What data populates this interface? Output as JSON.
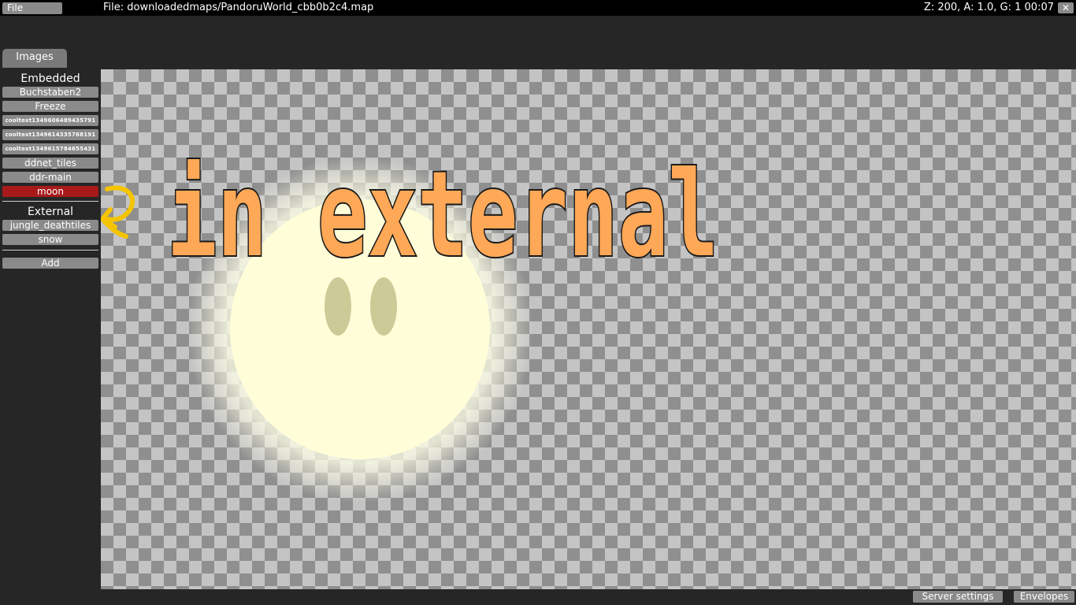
{
  "topbar": {
    "file_label": "File",
    "file_path": "File: downloadedmaps/PandoruWorld_cbb0b2c4.map",
    "status": "Z: 200, A: 1.0, G: 1  00:07",
    "close_glyph": "✕"
  },
  "tabs": [
    {
      "label": "Images",
      "active": true
    }
  ],
  "sidebar": {
    "embedded_title": "Embedded",
    "embedded_items": [
      {
        "label": "Buchstaben2"
      },
      {
        "label": "Freeze"
      },
      {
        "label": "cooltext1349606489435791"
      },
      {
        "label": "cooltext1349614335768191"
      },
      {
        "label": "cooltext1349615784655431"
      },
      {
        "label": "ddnet_tiles"
      },
      {
        "label": "ddr-main"
      },
      {
        "label": "moon",
        "selected": true
      }
    ],
    "external_title": "External",
    "external_items": [
      {
        "label": "jungle_deathtiles"
      },
      {
        "label": "snow"
      }
    ],
    "add_label": "Add"
  },
  "canvas": {
    "annotation_text": "in external",
    "annotation_fill": "#ffa857",
    "annotation_arrow_color": "#f5c400",
    "moon_color": "#fffed8",
    "moon_eye_color": "#cccb98"
  },
  "bottombar": {
    "server_settings_label": "Server settings",
    "envelopes_label": "Envelopes"
  },
  "colors": {
    "background": "#262626",
    "button": "#8a8a8a",
    "selected": "#a81a1a",
    "topbar": "#000000"
  }
}
